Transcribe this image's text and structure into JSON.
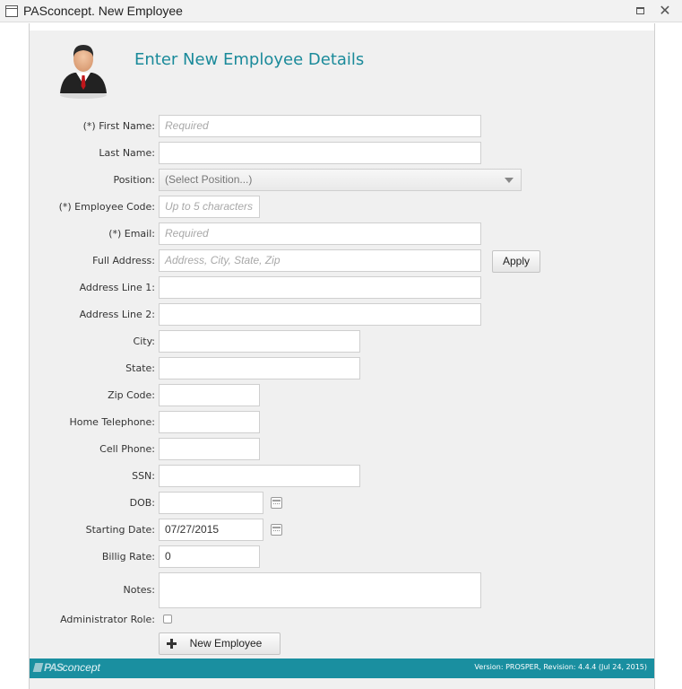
{
  "window": {
    "title": "PASconcept. New Employee"
  },
  "form": {
    "heading": "Enter New Employee Details",
    "fields": {
      "first_name": {
        "label": "(*) First Name:",
        "value": "",
        "placeholder": "Required"
      },
      "last_name": {
        "label": "Last Name:",
        "value": "",
        "placeholder": ""
      },
      "position": {
        "label": "Position:",
        "selected": "(Select Position...)"
      },
      "employee_code": {
        "label": "(*) Employee Code:",
        "value": "",
        "placeholder": "Up to 5 characters"
      },
      "email": {
        "label": "(*) Email:",
        "value": "",
        "placeholder": "Required"
      },
      "full_address": {
        "label": "Full Address:",
        "value": "",
        "placeholder": "Address, City, State, Zip"
      },
      "address_line1": {
        "label": "Address Line 1:",
        "value": ""
      },
      "address_line2": {
        "label": "Address Line 2:",
        "value": ""
      },
      "city": {
        "label": "City:",
        "value": ""
      },
      "state": {
        "label": "State:",
        "value": ""
      },
      "zip": {
        "label": "Zip Code:",
        "value": ""
      },
      "home_phone": {
        "label": "Home Telephone:",
        "value": ""
      },
      "cell_phone": {
        "label": "Cell Phone:",
        "value": ""
      },
      "ssn": {
        "label": "SSN:",
        "value": ""
      },
      "dob": {
        "label": "DOB:",
        "value": ""
      },
      "starting_date": {
        "label": "Starting Date:",
        "value": "07/27/2015"
      },
      "billing_rate": {
        "label": "Billig Rate:",
        "value": "0"
      },
      "notes": {
        "label": "Notes:",
        "value": ""
      },
      "admin_role": {
        "label": "Administrator Role:",
        "checked": false
      }
    },
    "apply_button": "Apply",
    "new_employee_button": "New Employee"
  },
  "footer": {
    "logo_bold": "PAS",
    "logo_rest": "concept",
    "version": "Version: PROSPER, Revision: 4.4.4 (Jul 24, 2015)"
  },
  "colors": {
    "accent": "#1a8a9a",
    "footer_bg": "#1a8fa0"
  },
  "icons": {
    "app": "window-icon",
    "maximize": "maximize-icon",
    "close": "close-icon",
    "avatar": "businessman-avatar",
    "calendar": "calendar-icon",
    "add": "plus-icon"
  }
}
